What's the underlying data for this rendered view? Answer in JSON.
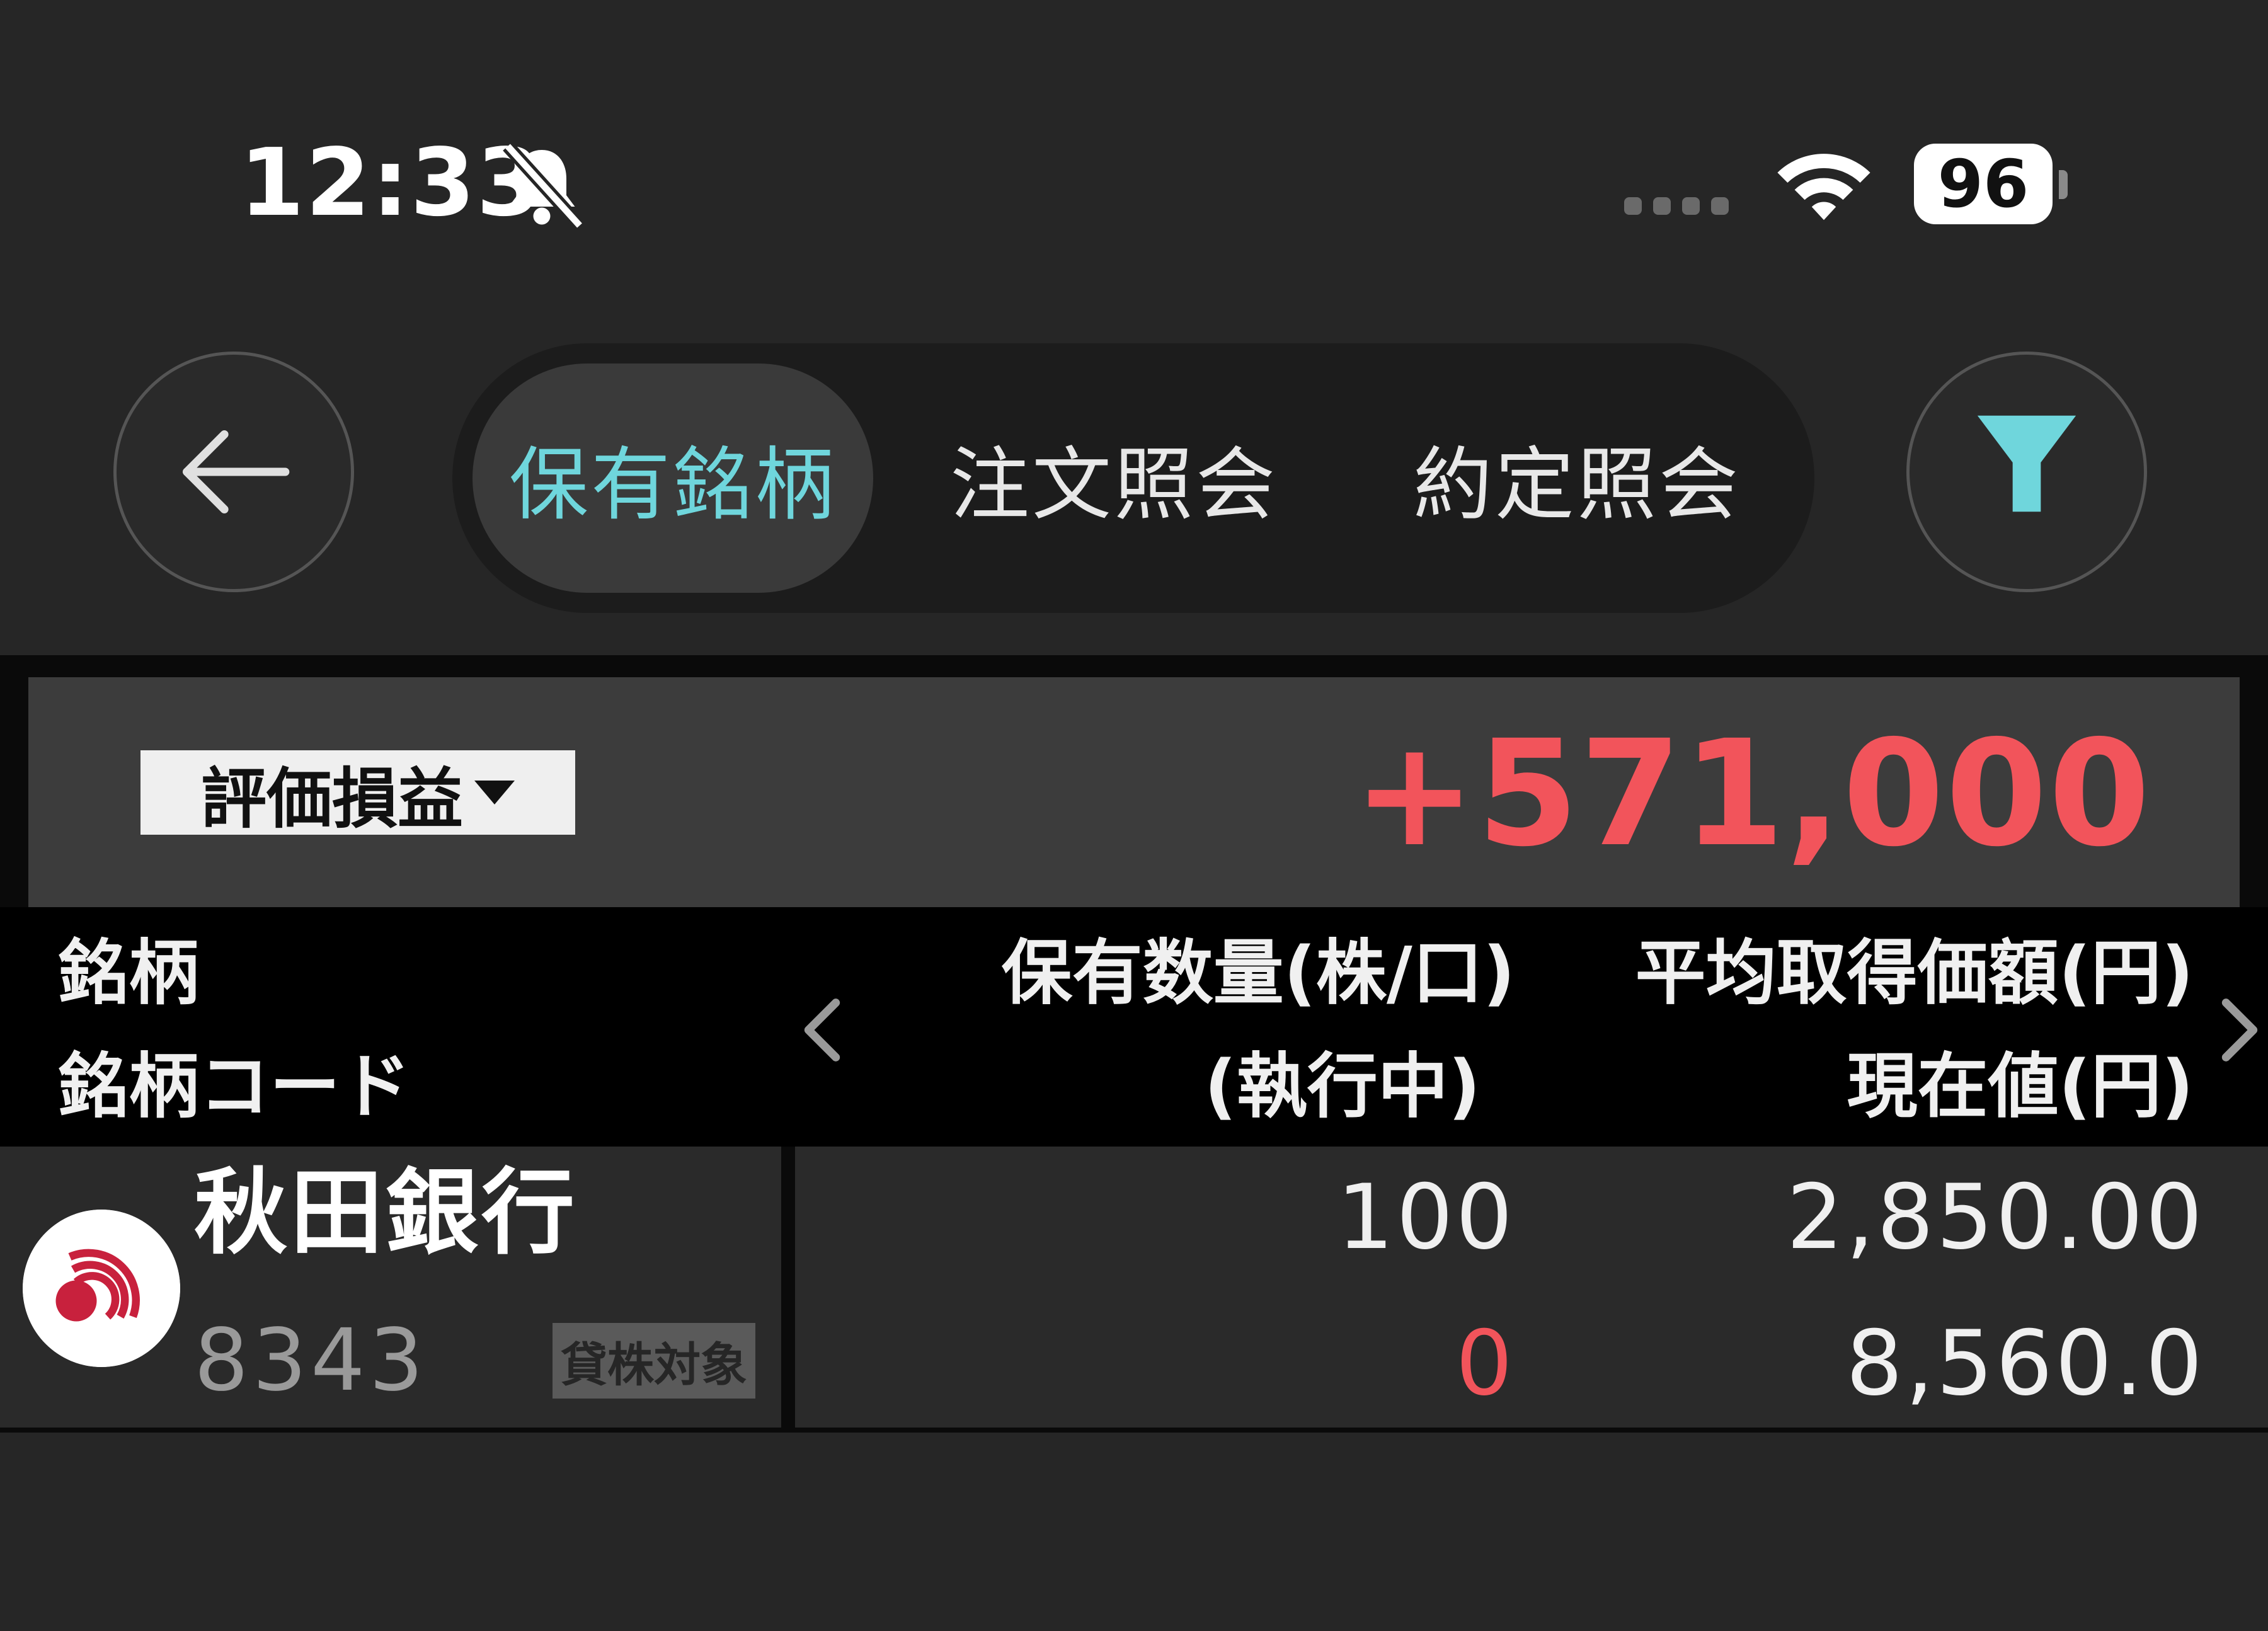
{
  "status_bar": {
    "time": "12:33",
    "battery": "96",
    "icons": [
      "bell-off-icon",
      "signal-dots-icon",
      "wifi-icon",
      "battery-icon"
    ]
  },
  "nav": {
    "back_icon": "arrow-left-icon",
    "filter_icon": "filter-icon",
    "tabs": [
      {
        "label": "保有銘柄",
        "active": true
      },
      {
        "label": "注文照会",
        "active": false
      },
      {
        "label": "約定照会",
        "active": false
      }
    ]
  },
  "summary": {
    "metric_label": "評価損益",
    "total_value": "+571,000"
  },
  "columns": {
    "name": "銘柄",
    "code": "銘柄コード",
    "quantity": "保有数量(株/口)",
    "executing": "(執行中)",
    "avg_price": "平均取得価額(円)",
    "current_price": "現在値(円)"
  },
  "holdings": [
    {
      "name": "秋田銀行",
      "code": "8343",
      "badge": "貸株対象",
      "quantity": "100",
      "executing": "0",
      "avg_price": "2,850.00",
      "current_price": "8,560.0"
    }
  ],
  "colors": {
    "accent": "#6fd6dc",
    "negative": "#f2545b",
    "background": "#262626",
    "logo_red": "#c8213d"
  }
}
